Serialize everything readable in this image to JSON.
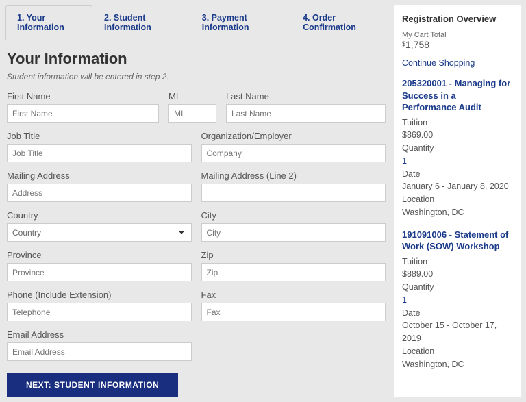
{
  "tabs": [
    {
      "label": "1. Your Information"
    },
    {
      "label": "2. Student Information"
    },
    {
      "label": "3. Payment Information"
    },
    {
      "label": "4. Order Confirmation"
    }
  ],
  "heading": "Your Information",
  "subtitle": "Student information will be entered in step 2.",
  "fields": {
    "firstName": {
      "label": "First Name",
      "placeholder": "First Name"
    },
    "mi": {
      "label": "MI",
      "placeholder": "MI"
    },
    "lastName": {
      "label": "Last Name",
      "placeholder": "Last Name"
    },
    "jobTitle": {
      "label": "Job Title",
      "placeholder": "Job Title"
    },
    "organization": {
      "label": "Organization/Employer",
      "placeholder": "Company"
    },
    "address": {
      "label": "Mailing Address",
      "placeholder": "Address"
    },
    "address2": {
      "label": "Mailing Address (Line 2)",
      "placeholder": ""
    },
    "country": {
      "label": "Country",
      "selected": "Country"
    },
    "city": {
      "label": "City",
      "placeholder": "City"
    },
    "province": {
      "label": "Province",
      "placeholder": "Province"
    },
    "zip": {
      "label": "Zip",
      "placeholder": "Zip"
    },
    "phone": {
      "label": "Phone (Include Extension)",
      "placeholder": "Telephone"
    },
    "fax": {
      "label": "Fax",
      "placeholder": "Fax"
    },
    "email": {
      "label": "Email Address",
      "placeholder": "Email Address"
    }
  },
  "nextButton": "NEXT: STUDENT INFORMATION",
  "sidebar": {
    "heading": "Registration Overview",
    "cartLabel": "My Cart Total",
    "cartCurrency": "$",
    "cartTotal": "1,758",
    "continueLink": "Continue Shopping",
    "courses": [
      {
        "title": "205320001 - Managing for Success in a Performance Audit",
        "tuitionLabel": "Tuition",
        "tuition": "$869.00",
        "quantityLabel": "Quantity",
        "quantity": "1",
        "dateLabel": "Date",
        "date": "January 6 - January 8, 2020",
        "locationLabel": "Location",
        "location": "Washington, DC"
      },
      {
        "title": "191091006 - Statement of Work (SOW) Workshop",
        "tuitionLabel": "Tuition",
        "tuition": "$889.00",
        "quantityLabel": "Quantity",
        "quantity": "1",
        "dateLabel": "Date",
        "date": "October 15 - October 17, 2019",
        "locationLabel": "Location",
        "location": "Washington, DC"
      }
    ]
  }
}
